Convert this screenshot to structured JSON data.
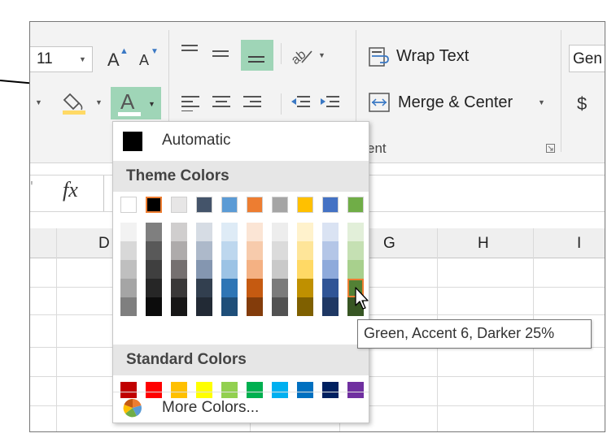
{
  "ribbon": {
    "font_size_value": "11",
    "grow_font_label": "A",
    "shrink_font_label": "A",
    "font_color_label": "A",
    "wrap_text_label": "Wrap Text",
    "merge_center_label": "Merge & Center",
    "alignment_group_label": "ent",
    "number_format_value": "Gen",
    "currency_symbol": "$"
  },
  "formula_bar": {
    "fx_label": "fx"
  },
  "columns": [
    "D",
    "G",
    "H",
    "I"
  ],
  "dropdown": {
    "automatic_label": "Automatic",
    "theme_colors_label": "Theme Colors",
    "standard_colors_label": "Standard Colors",
    "more_colors_label": "More Colors...",
    "theme_colors": [
      [
        "#ffffff",
        "#000000",
        "#e7e6e6",
        "#44546a",
        "#5b9bd5",
        "#ed7d31",
        "#a5a5a5",
        "#ffc000",
        "#4472c4",
        "#70ad47"
      ],
      [
        "#f2f2f2",
        "#7f7f7f",
        "#d0cece",
        "#d6dce4",
        "#deebf6",
        "#fbe5d5",
        "#ededed",
        "#fff2cc",
        "#dae3f3",
        "#e2efd9"
      ],
      [
        "#d8d8d8",
        "#595959",
        "#aeabab",
        "#adb9ca",
        "#bdd7ee",
        "#f7cbac",
        "#dbdbdb",
        "#fee599",
        "#b4c6e7",
        "#c5e0b3"
      ],
      [
        "#bfbfbf",
        "#3f3f3f",
        "#757070",
        "#8496b0",
        "#9cc3e5",
        "#f4b183",
        "#c9c9c9",
        "#ffd965",
        "#8eaadb",
        "#a8d08d"
      ],
      [
        "#a5a5a5",
        "#262626",
        "#3a3838",
        "#323f4f",
        "#2e75b5",
        "#c55a11",
        "#7b7b7b",
        "#bf9000",
        "#2f5496",
        "#538135"
      ],
      [
        "#7f7f7f",
        "#0c0c0c",
        "#171616",
        "#222a35",
        "#1e4e79",
        "#833c0b",
        "#525252",
        "#7f6000",
        "#1f3864",
        "#375623"
      ]
    ],
    "standard_colors": [
      "#c00000",
      "#ff0000",
      "#ffc000",
      "#ffff00",
      "#92d050",
      "#00b050",
      "#00b0f0",
      "#0070c0",
      "#002060",
      "#7030a0"
    ]
  },
  "tooltip": {
    "text": "Green, Accent 6, Darker 25%"
  }
}
